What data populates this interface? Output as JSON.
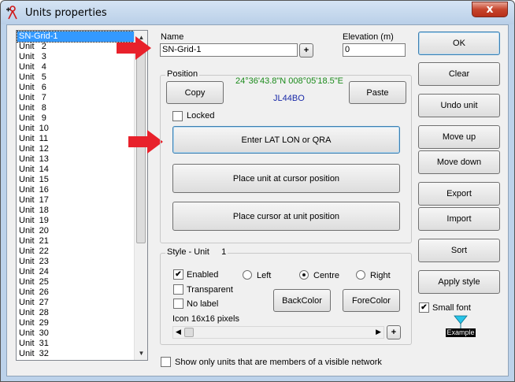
{
  "window": {
    "title": "Units properties",
    "close_label": "x"
  },
  "units_list": {
    "items": [
      "SN-Grid-1",
      "Unit   2",
      "Unit   3",
      "Unit   4",
      "Unit   5",
      "Unit   6",
      "Unit   7",
      "Unit   8",
      "Unit   9",
      "Unit  10",
      "Unit  11",
      "Unit  12",
      "Unit  13",
      "Unit  14",
      "Unit  15",
      "Unit  16",
      "Unit  17",
      "Unit  18",
      "Unit  19",
      "Unit  20",
      "Unit  21",
      "Unit  22",
      "Unit  23",
      "Unit  24",
      "Unit  25",
      "Unit  26",
      "Unit  27",
      "Unit  28",
      "Unit  29",
      "Unit  30",
      "Unit  31",
      "Unit  32"
    ],
    "selected_index": 0
  },
  "name_field": {
    "label": "Name",
    "value": "SN-Grid-1",
    "plus_label": "+"
  },
  "elevation_field": {
    "label": "Elevation (m)",
    "value": "0"
  },
  "position": {
    "title": "Position",
    "coords": "24°36'43.8\"N 008°05'18.5\"E",
    "locator": "JL44BO",
    "copy_label": "Copy",
    "paste_label": "Paste",
    "locked_label": "Locked",
    "locked_checked": false,
    "enter_label": "Enter LAT LON or QRA",
    "place_unit_label": "Place unit at cursor position",
    "place_cursor_label": "Place cursor at unit position"
  },
  "style": {
    "title": "Style - Unit     1",
    "enabled_label": "Enabled",
    "enabled_checked": "✔",
    "transparent_label": "Transparent",
    "nolabel_label": "No label",
    "left_label": "Left",
    "centre_label": "Centre",
    "right_label": "Right",
    "alignment_selected": "Centre",
    "backcolor_label": "BackColor",
    "forecolor_label": "ForeColor",
    "icon_label": "Icon 16x16 pixels",
    "plus_label": "+"
  },
  "side_buttons": {
    "ok": "OK",
    "clear": "Clear",
    "undo": "Undo unit",
    "move_up": "Move up",
    "move_down": "Move down",
    "export": "Export",
    "import": "Import",
    "sort": "Sort",
    "apply_style": "Apply style"
  },
  "small_font": {
    "label": "Small font",
    "checked": "✔"
  },
  "example": {
    "label": "Example"
  },
  "show_only": {
    "label": "Show only units that are members of a visible network",
    "checked": false
  },
  "colors": {
    "coords_green": "#1a8a1a",
    "locator_blue": "#1a2aa8",
    "arrow_red": "#e8212b",
    "selection_blue": "#3399ff",
    "icon_cyan": "#27c4e8"
  }
}
